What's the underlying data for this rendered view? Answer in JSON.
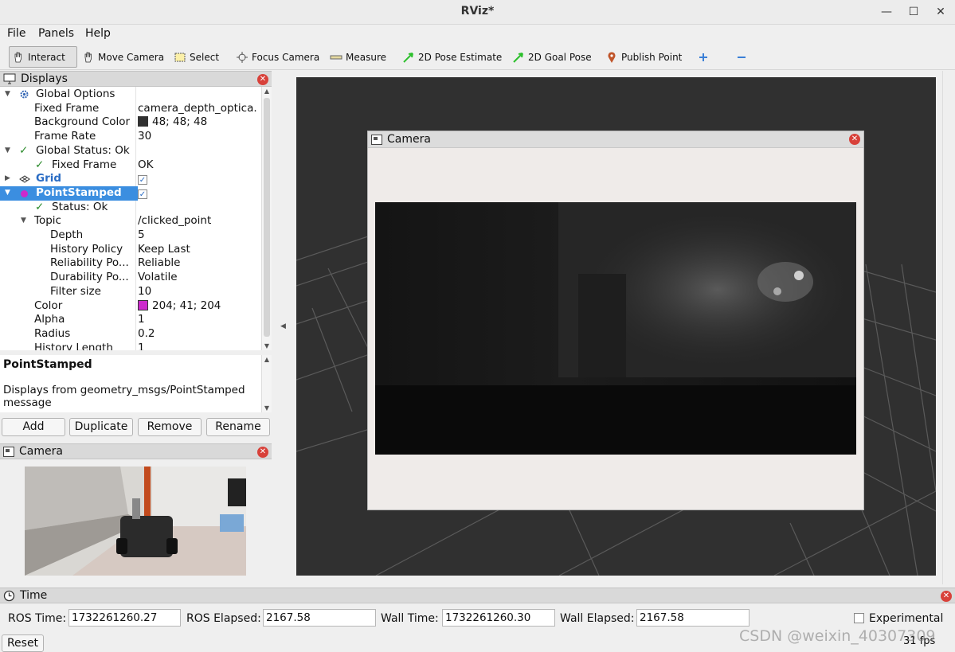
{
  "window": {
    "title": "RViz*",
    "minimize": "—",
    "maximize": "☐",
    "close": "✕"
  },
  "menu": [
    "File",
    "Panels",
    "Help"
  ],
  "toolbar": [
    {
      "label": "Interact",
      "icon": "hand-icon"
    },
    {
      "label": "Move Camera",
      "icon": "move-camera-icon"
    },
    {
      "label": "Select",
      "icon": "select-icon"
    },
    {
      "label": "Focus Camera",
      "icon": "focus-camera-icon"
    },
    {
      "label": "Measure",
      "icon": "ruler-icon"
    },
    {
      "label": "2D Pose Estimate",
      "icon": "green-arrow-icon"
    },
    {
      "label": "2D Goal Pose",
      "icon": "green-arrow-icon"
    },
    {
      "label": "Publish Point",
      "icon": "map-pin-icon"
    }
  ],
  "displays": {
    "title": "Displays",
    "rows": [
      {
        "key": "Global Options",
        "value": ""
      },
      {
        "key": "Fixed Frame",
        "value": "camera_depth_optica."
      },
      {
        "key": "Background Color",
        "value": "48; 48; 48",
        "color": "#303030"
      },
      {
        "key": "Frame Rate",
        "value": "30"
      },
      {
        "key": "Global Status: Ok",
        "value": ""
      },
      {
        "key": "Fixed Frame",
        "value": "OK"
      },
      {
        "key": "Grid",
        "value": "✓"
      },
      {
        "key": "PointStamped",
        "value": "✓"
      },
      {
        "key": "Status: Ok",
        "value": ""
      },
      {
        "key": "Topic",
        "value": "/clicked_point"
      },
      {
        "key": "Depth",
        "value": "5"
      },
      {
        "key": "History Policy",
        "value": "Keep Last"
      },
      {
        "key": "Reliability Po...",
        "value": "Reliable"
      },
      {
        "key": "Durability Po...",
        "value": "Volatile"
      },
      {
        "key": "Filter size",
        "value": "10"
      },
      {
        "key": "Color",
        "value": "204; 41; 204",
        "color": "#cc29cc"
      },
      {
        "key": "Alpha",
        "value": "1"
      },
      {
        "key": "Radius",
        "value": "0.2"
      },
      {
        "key": "History Length",
        "value": "1"
      }
    ]
  },
  "description": {
    "title": "PointStamped",
    "text": "Displays from geometry_msgs/PointStamped message"
  },
  "buttons": {
    "add": "Add",
    "duplicate": "Duplicate",
    "remove": "Remove",
    "rename": "Rename"
  },
  "camera_panel": {
    "title": "Camera"
  },
  "camera_float": {
    "title": "Camera"
  },
  "time": {
    "title": "Time",
    "ros_time_label": "ROS Time:",
    "ros_time": "1732261260.27",
    "ros_elapsed_label": "ROS Elapsed:",
    "ros_elapsed": "2167.58",
    "wall_time_label": "Wall Time:",
    "wall_time": "1732261260.30",
    "wall_elapsed_label": "Wall Elapsed:",
    "wall_elapsed": "2167.58",
    "experimental": "Experimental",
    "reset": "Reset",
    "fps": "31 fps"
  },
  "watermark": "CSDN @weixin_40307309"
}
